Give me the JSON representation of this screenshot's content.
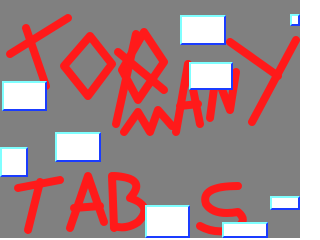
{
  "scene": {
    "background_color": "#808080",
    "scribble_color": "#ff1a1a",
    "tab_fill_color": "#ffffff",
    "tab_border_color": "#1a3cff",
    "tab_highlight_color": "#7fffff",
    "tab_count": 9
  },
  "scribble_text": {
    "line1": "TOO",
    "line2": "MANY",
    "line3": "TABS"
  }
}
